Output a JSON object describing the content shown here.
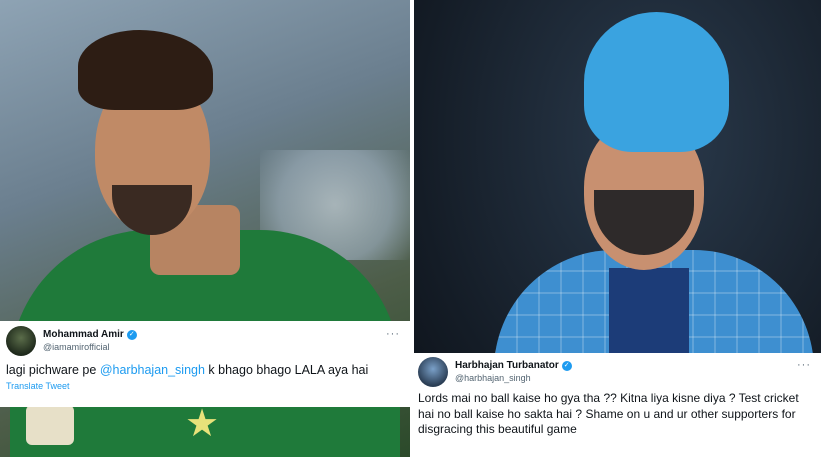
{
  "tweets": [
    {
      "display_name": "Mohammad Amir",
      "handle": "@iamamirofficial",
      "body_before": "lagi pichware pe ",
      "mention": "@harbhajan_singh",
      "body_after": "  k bhago bhago LALA aya hai",
      "translate_label": "Translate Tweet",
      "more_icon": "···"
    },
    {
      "display_name": "Harbhajan Turbanator",
      "handle": "@harbhajan_singh",
      "body": "Lords mai no ball kaise ho gya tha ?? Kitna liya kisne diya ? Test cricket hai no ball kaise ho sakta hai ? Shame on u and ur other supporters for disgracing this beautiful game",
      "more_icon": "···"
    }
  ],
  "verified_glyph": "✓",
  "colors": {
    "link": "#1d9bf0",
    "verified": "#1d9bf0",
    "text": "#0f1419",
    "muted": "#536471"
  }
}
